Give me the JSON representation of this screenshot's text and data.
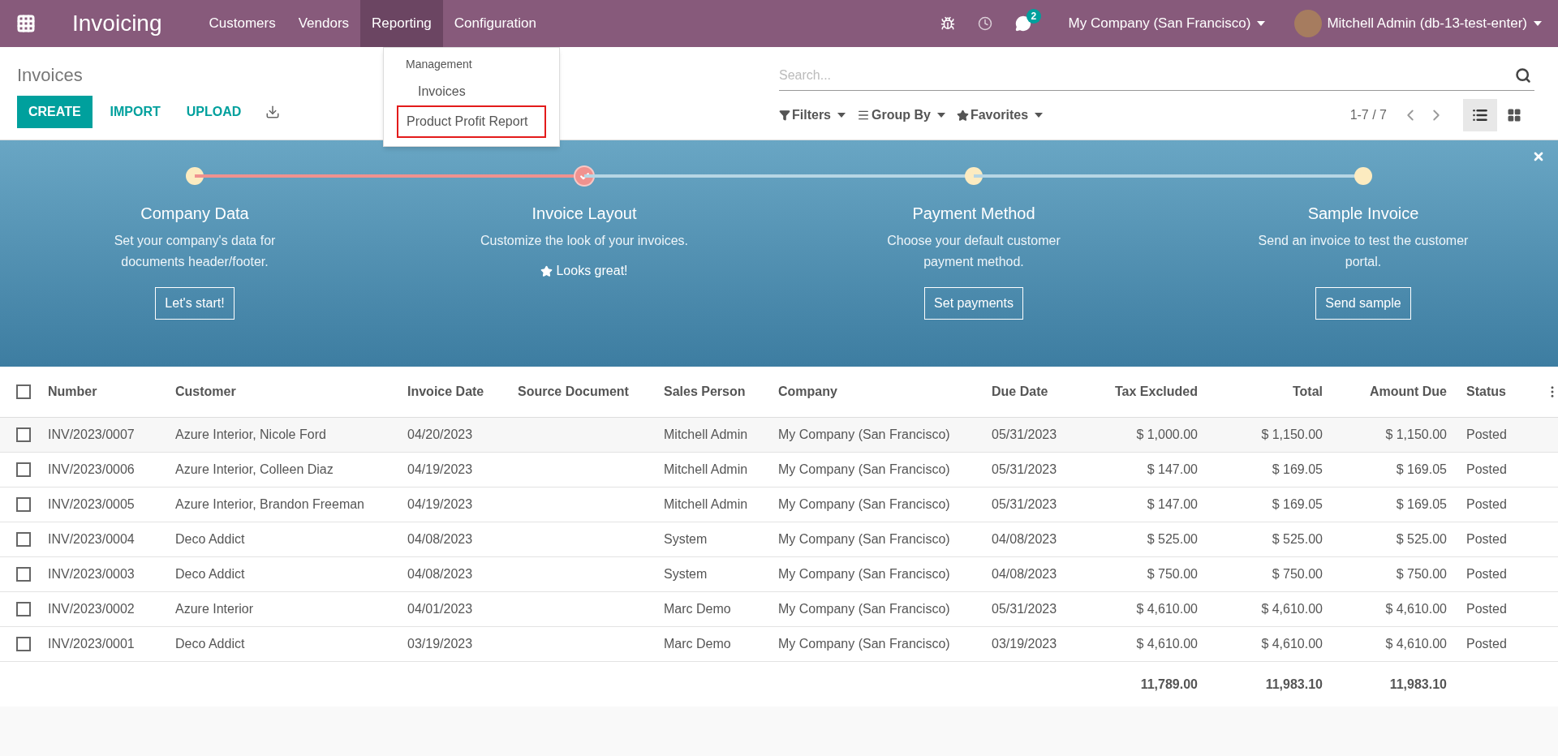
{
  "navbar": {
    "app_title": "Invoicing",
    "menu": [
      {
        "label": "Customers",
        "selected": false
      },
      {
        "label": "Vendors",
        "selected": false
      },
      {
        "label": "Reporting",
        "selected": true
      },
      {
        "label": "Configuration",
        "selected": false
      }
    ],
    "messages_badge": "2",
    "company": "My Company (San Francisco)",
    "user": "Mitchell Admin (db-13-test-enter)"
  },
  "dropdown": {
    "header": "Management",
    "items": [
      {
        "label": "Invoices",
        "highlighted": false
      },
      {
        "label": "Product Profit Report",
        "highlighted": true
      }
    ]
  },
  "control_panel": {
    "title": "Invoices",
    "buttons": [
      {
        "label": "CREATE",
        "kind": "primary"
      },
      {
        "label": "IMPORT",
        "kind": "link"
      },
      {
        "label": "UPLOAD",
        "kind": "link"
      }
    ],
    "search": {
      "placeholder": "Search..."
    },
    "filters": [
      "Filters",
      "Group By",
      "Favorites"
    ],
    "pager": "1-7 / 7",
    "views": [
      {
        "kind": "list",
        "selected": true
      },
      {
        "kind": "kanban",
        "selected": false
      }
    ]
  },
  "onboarding": {
    "steps": [
      {
        "title": "Company Data",
        "description": "Set your company's data for documents header/footer.",
        "done": false,
        "button": "Let's start!"
      },
      {
        "title": "Invoice Layout",
        "description": "Customize the look of your invoices.",
        "done": true,
        "done_label": "Looks great!"
      },
      {
        "title": "Payment Method",
        "description": "Choose your default customer payment method.",
        "done": false,
        "button": "Set payments"
      },
      {
        "title": "Sample Invoice",
        "description": "Send an invoice to test the customer portal.",
        "done": false,
        "button": "Send sample"
      }
    ]
  },
  "table": {
    "header_checked": false,
    "columns": [
      "Number",
      "Customer",
      "Invoice Date",
      "Source Document",
      "Sales Person",
      "Company",
      "Due Date",
      "Tax Excluded",
      "Total",
      "Amount Due",
      "Status"
    ],
    "rows": [
      {
        "checked": false,
        "hovered": true,
        "cells": [
          "INV/2023/0007",
          "Azure Interior, Nicole Ford",
          "04/20/2023",
          "",
          "Mitchell Admin",
          "My Company (San Francisco)",
          "05/31/2023",
          "$ 1,000.00",
          "$ 1,150.00",
          "$ 1,150.00",
          "Posted"
        ]
      },
      {
        "checked": false,
        "cells": [
          "INV/2023/0006",
          "Azure Interior, Colleen Diaz",
          "04/19/2023",
          "",
          "Mitchell Admin",
          "My Company (San Francisco)",
          "05/31/2023",
          "$ 147.00",
          "$ 169.05",
          "$ 169.05",
          "Posted"
        ]
      },
      {
        "checked": false,
        "cells": [
          "INV/2023/0005",
          "Azure Interior, Brandon Freeman",
          "04/19/2023",
          "",
          "Mitchell Admin",
          "My Company (San Francisco)",
          "05/31/2023",
          "$ 147.00",
          "$ 169.05",
          "$ 169.05",
          "Posted"
        ]
      },
      {
        "checked": false,
        "cells": [
          "INV/2023/0004",
          "Deco Addict",
          "04/08/2023",
          "",
          "System",
          "My Company (San Francisco)",
          "04/08/2023",
          "$ 525.00",
          "$ 525.00",
          "$ 525.00",
          "Posted"
        ]
      },
      {
        "checked": false,
        "cells": [
          "INV/2023/0003",
          "Deco Addict",
          "04/08/2023",
          "",
          "System",
          "My Company (San Francisco)",
          "04/08/2023",
          "$ 750.00",
          "$ 750.00",
          "$ 750.00",
          "Posted"
        ]
      },
      {
        "checked": false,
        "cells": [
          "INV/2023/0002",
          "Azure Interior",
          "04/01/2023",
          "",
          "Marc Demo",
          "My Company (San Francisco)",
          "05/31/2023",
          "$ 4,610.00",
          "$ 4,610.00",
          "$ 4,610.00",
          "Posted"
        ]
      },
      {
        "checked": false,
        "cells": [
          "INV/2023/0001",
          "Deco Addict",
          "03/19/2023",
          "",
          "Marc Demo",
          "My Company (San Francisco)",
          "03/19/2023",
          "$ 4,610.00",
          "$ 4,610.00",
          "$ 4,610.00",
          "Posted"
        ]
      }
    ],
    "totals": [
      "11,789.00",
      "11,983.10",
      "11,983.10"
    ]
  }
}
